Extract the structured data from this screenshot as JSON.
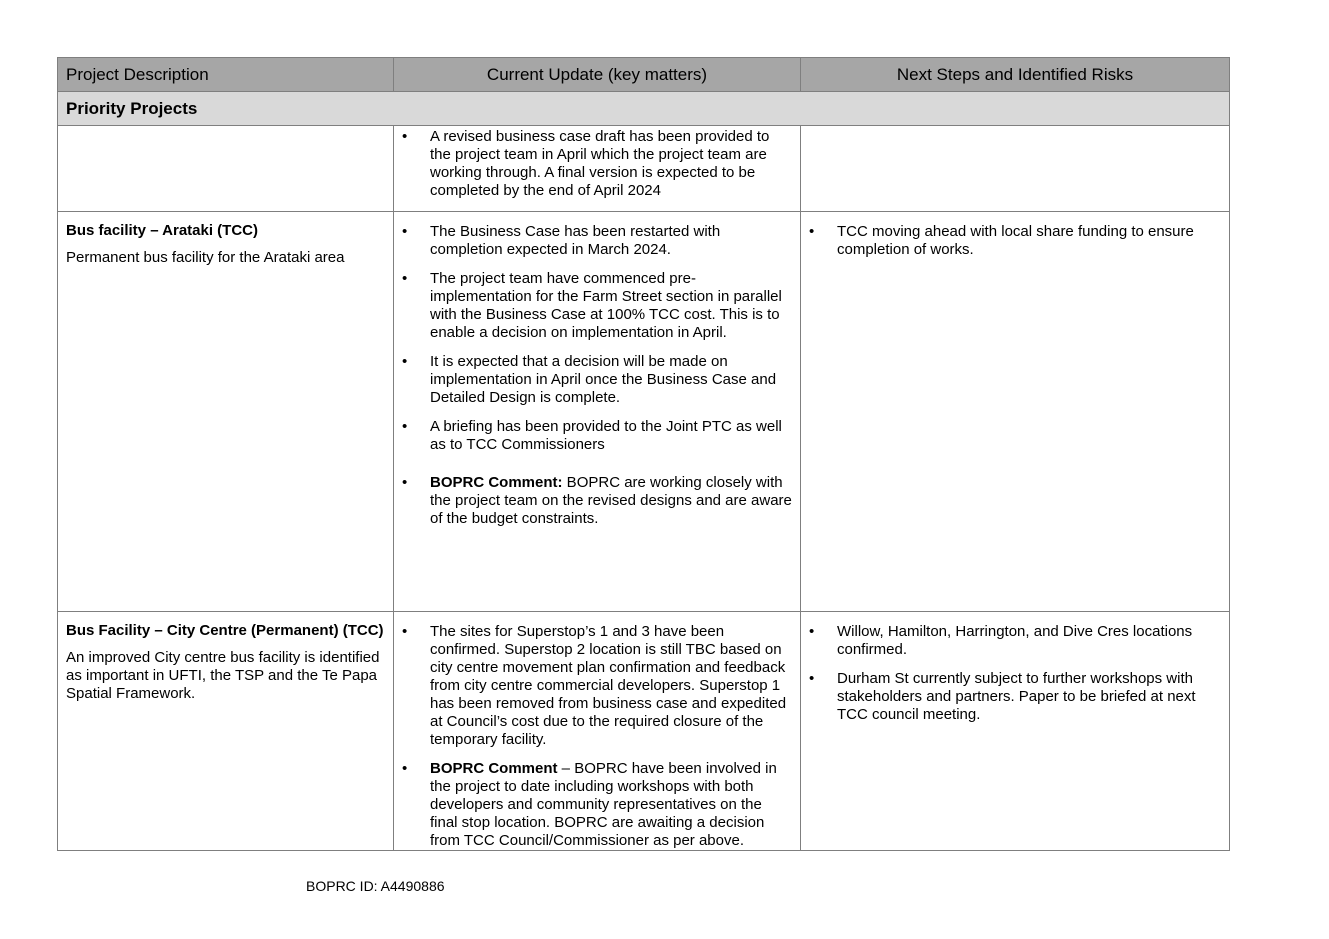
{
  "table": {
    "headers": [
      "Project Description",
      "Current Update (key matters)",
      "Next Steps and Identified Risks"
    ],
    "section_title": "Priority Projects",
    "rows": [
      {
        "title": "",
        "description": "",
        "updates": [
          "A revised business case draft has been provided to the project team in April which the project team are working through. A final version is expected to be completed by the end of April 2024"
        ],
        "risks": []
      },
      {
        "title": "Bus facility – Arataki (TCC)",
        "description": "Permanent bus facility for the Arataki area",
        "updates": [
          "The Business Case has been restarted with completion expected in March 2024.",
          "The project team have commenced pre-implementation for the Farm Street section in parallel with the Business Case at 100% TCC cost. This is to enable a decision on implementation in April.",
          "It is expected that a decision will be made on implementation in April once the Business Case and Detailed Design is complete.",
          "A briefing has been provided to the Joint PTC as well as to TCC Commissioners"
        ],
        "comment_label": "BOPRC Comment:",
        "comment_text": " BOPRC are working closely with the project team on the revised designs and are aware of the budget constraints.",
        "risks": [
          "TCC moving ahead with local share funding to ensure completion of works."
        ]
      },
      {
        "title": "Bus Facility – City Centre (Permanent) (TCC)",
        "description": "An improved City centre bus facility is identified as important in UFTI, the TSP and the Te Papa Spatial Framework.",
        "updates": [
          "The sites for Superstop’s 1 and 3 have been confirmed. Superstop 2 location is still TBC based on city centre movement plan confirmation and feedback from city centre commercial developers. Superstop 1 has been removed from business case and expedited at Council’s cost due to the required closure of the temporary facility."
        ],
        "comment_label": "BOPRC Comment",
        "comment_text": " – BOPRC have been involved in the project to date including workshops with both developers and community representatives on the final stop location. BOPRC are awaiting a decision from TCC Council/Commissioner as per above.",
        "risks": [
          "Willow, Hamilton, Harrington, and Dive Cres locations confirmed.",
          "Durham St currently subject to further workshops with stakeholders and partners. Paper to be briefed at next TCC council meeting."
        ]
      }
    ]
  },
  "footer": {
    "doc_id": "BOPRC ID: A4490886"
  }
}
